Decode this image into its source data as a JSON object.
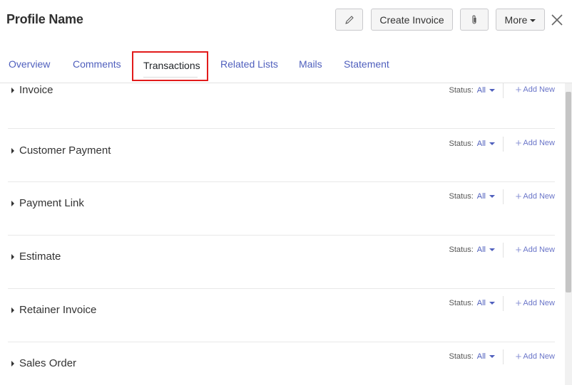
{
  "header": {
    "title": "Profile Name",
    "create_invoice_label": "Create Invoice",
    "more_label": "More",
    "edit_icon": "pencil-icon",
    "attach_icon": "paperclip-icon",
    "close_icon": "close-icon"
  },
  "tabs": [
    {
      "label": "Overview"
    },
    {
      "label": "Comments"
    },
    {
      "label": "Transactions",
      "active": true
    },
    {
      "label": "Related Lists"
    },
    {
      "label": "Mails"
    },
    {
      "label": "Statement"
    }
  ],
  "sections": [
    {
      "title": "Invoice",
      "status_label": "Status:",
      "status_value": "All",
      "add_label": "Add New"
    },
    {
      "title": "Customer Payment",
      "status_label": "Status:",
      "status_value": "All",
      "add_label": "Add New"
    },
    {
      "title": "Payment Link",
      "status_label": "Status:",
      "status_value": "All",
      "add_label": "Add New"
    },
    {
      "title": "Estimate",
      "status_label": "Status:",
      "status_value": "All",
      "add_label": "Add New"
    },
    {
      "title": "Retainer Invoice",
      "status_label": "Status:",
      "status_value": "All",
      "add_label": "Add New"
    },
    {
      "title": "Sales Order",
      "status_label": "Status:",
      "status_value": "All",
      "add_label": "Add New"
    }
  ],
  "colors": {
    "accent": "#4f5fbd",
    "highlight": "#e21b1b"
  }
}
